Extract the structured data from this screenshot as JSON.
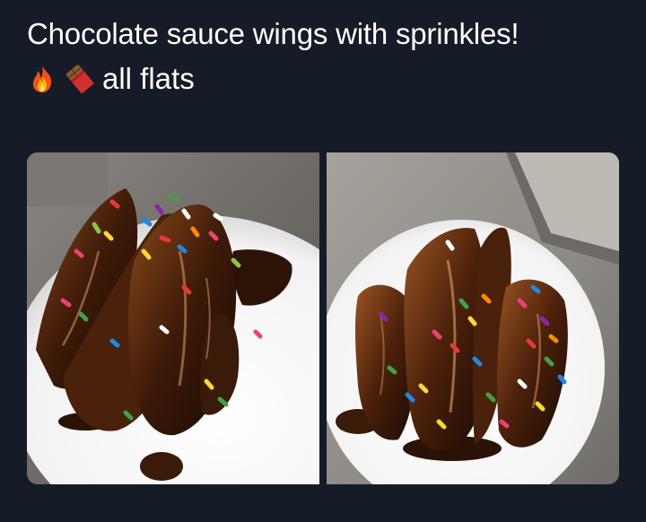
{
  "post": {
    "caption_line1": "Chocolate sauce wings with sprinkles!",
    "caption_line2": "all flats",
    "emojis": [
      "fire-emoji",
      "chocolate-bar-emoji"
    ]
  },
  "photos": [
    {
      "name": "wings-photo-left"
    },
    {
      "name": "wings-photo-right"
    }
  ],
  "colors": {
    "background": "#151c28",
    "text": "#ffffff"
  }
}
